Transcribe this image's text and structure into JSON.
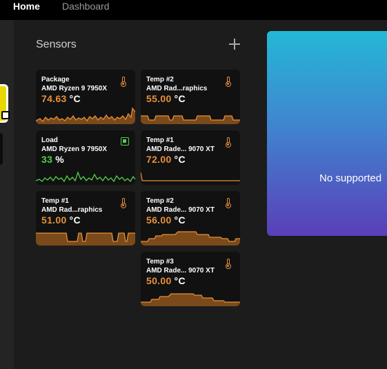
{
  "topbar": {
    "tabs": [
      {
        "label": "Home"
      },
      {
        "label": "Dashboard"
      }
    ]
  },
  "sensors": {
    "title": "Sensors",
    "add_icon": "plus-icon",
    "cards": [
      {
        "name": "Package",
        "device": "AMD Ryzen 9 7950X",
        "value": "74.63",
        "unit": "°C",
        "icon": "thermometer-icon",
        "color": "#e8913a"
      },
      {
        "name": "Temp #2",
        "device": "AMD Rad...raphics",
        "value": "55.00",
        "unit": "°C",
        "icon": "thermometer-icon",
        "color": "#e8913a"
      },
      {
        "name": "Load",
        "device": "AMD Ryzen 9 7950X",
        "value": "33",
        "unit": "%",
        "icon": "cpu-chip-icon",
        "color": "#52d348"
      },
      {
        "name": "Temp #1",
        "device": "AMD Rade... 9070 XT",
        "value": "72.00",
        "unit": "°C",
        "icon": "thermometer-icon",
        "color": "#e8913a"
      },
      {
        "name": "Temp #1",
        "device": "AMD Rad...raphics",
        "value": "51.00",
        "unit": "°C",
        "icon": "thermometer-icon",
        "color": "#e8913a"
      },
      {
        "name": "Temp #2",
        "device": "AMD Rade... 9070 XT",
        "value": "56.00",
        "unit": "°C",
        "icon": "thermometer-icon",
        "color": "#e8913a"
      },
      {
        "name": "Temp #3",
        "device": "AMD Rade... 9070 XT",
        "value": "50.00",
        "unit": "°C",
        "icon": "thermometer-icon",
        "color": "#e8913a"
      }
    ]
  },
  "panel": {
    "message": "No supported"
  }
}
